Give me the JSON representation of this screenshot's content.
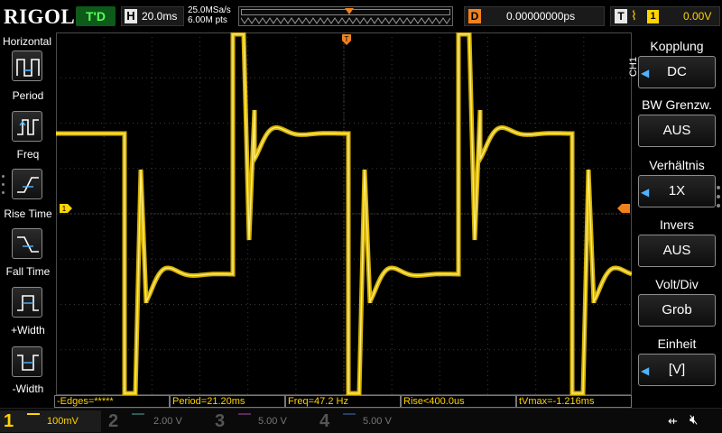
{
  "top": {
    "logo": "RIGOL",
    "trigger_status": "T'D",
    "horizontal_tag": "H",
    "timebase": "20.0ms",
    "sample_rate": "25.0MSa/s",
    "memory_depth": "6.00M pts",
    "delay_tag": "D",
    "delay": "0.00000000ps",
    "trigger_tag": "T",
    "trigger_edge_symbol": "⌇",
    "trigger_source": "1",
    "trigger_level": "0.00V"
  },
  "left_menu": {
    "title": "Horizontal",
    "items": [
      {
        "label": "Period",
        "icon": "period-icon"
      },
      {
        "label": "Freq",
        "icon": "freq-icon"
      },
      {
        "label": "Rise Time",
        "icon": "rise-time-icon"
      },
      {
        "label": "Fall Time",
        "icon": "fall-time-icon"
      },
      {
        "label": "+Width",
        "icon": "positive-width-icon"
      },
      {
        "label": "-Width",
        "icon": "negative-width-icon"
      }
    ]
  },
  "markers": {
    "trigger_position": "T",
    "channel1_ref": "1"
  },
  "right_menu": {
    "channel_label": "CH1",
    "items": [
      {
        "title": "Kopplung",
        "value": "DC",
        "has_arrow": true
      },
      {
        "title": "BW Grenzw.",
        "value": "AUS",
        "has_arrow": false
      },
      {
        "title": "Verhältnis",
        "value": "1X",
        "has_arrow": true
      },
      {
        "title": "Invers",
        "value": "AUS",
        "has_arrow": false
      },
      {
        "title": "Volt/Div",
        "value": "Grob",
        "has_arrow": false
      },
      {
        "title": "Einheit",
        "value": "[V]",
        "has_arrow": true
      }
    ]
  },
  "measurements": [
    "-Edges=*****",
    "Period=21.20ms",
    "Freq=47.2 Hz",
    "Rise<400.0us",
    "tVmax=-1.216ms"
  ],
  "channels": [
    {
      "num": "1",
      "scale": "100mV",
      "color": "#ffd400",
      "active": true
    },
    {
      "num": "2",
      "scale": "2.00 V",
      "color": "#00c8c8",
      "active": false
    },
    {
      "num": "3",
      "scale": "5.00 V",
      "color": "#d040d0",
      "active": false
    },
    {
      "num": "4",
      "scale": "5.00 V",
      "color": "#3c78ff",
      "active": false
    }
  ],
  "colors": {
    "trace": "#ffd400",
    "grid": "#3a3a3a",
    "trigger_marker": "#f0821e",
    "menu_arrow": "#4fb3ff"
  }
}
